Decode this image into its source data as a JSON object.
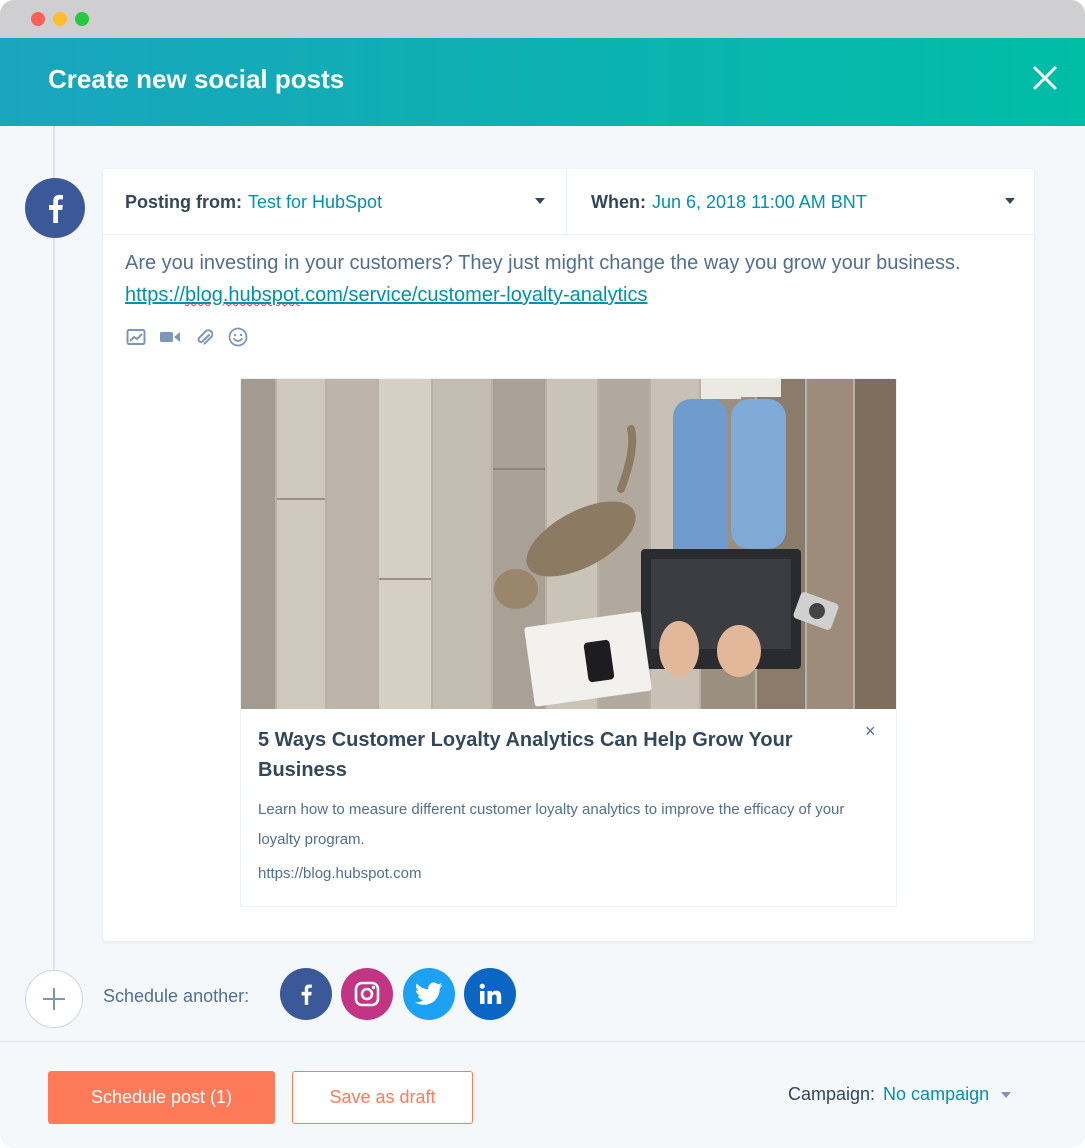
{
  "window": {
    "title": "Create new social posts"
  },
  "post": {
    "network_icon": "facebook-icon",
    "posting_from_label": "Posting from:",
    "posting_from_value": "Test for HubSpot",
    "when_label": "When:",
    "when_value": "Jun 6, 2018 11:00 AM BNT",
    "message_text": "Are you investing in your customers? They just might change the way you grow your business.",
    "message_link_prefix": "https://",
    "message_link_domain": "blog.hubspot",
    "message_link_rest": ".com/service/customer-loyalty-analytics",
    "toolbar_icons": [
      "image-icon",
      "video-icon",
      "attachment-icon",
      "emoji-icon"
    ]
  },
  "link_preview": {
    "title": "5 Ways Customer Loyalty Analytics Can Help Grow Your Business",
    "description": "Learn how to measure different customer loyalty analytics to improve the efficacy of your loyalty program.",
    "url": "https://blog.hubspot.com",
    "close_label": "×"
  },
  "schedule_another": {
    "label": "Schedule another:",
    "networks": [
      "facebook",
      "instagram",
      "twitter",
      "linkedin"
    ]
  },
  "footer": {
    "schedule_button": "Schedule post (1)",
    "draft_button": "Save as draft",
    "campaign_label": "Campaign:",
    "campaign_value": "No campaign"
  },
  "colors": {
    "header_start": "#1aa5be",
    "header_end": "#00bda5",
    "primary": "#ff7a59",
    "link": "#0091ae",
    "facebook": "#3b5998",
    "instagram": "#c13584",
    "twitter": "#1da1f2",
    "linkedin": "#0a66c2"
  }
}
